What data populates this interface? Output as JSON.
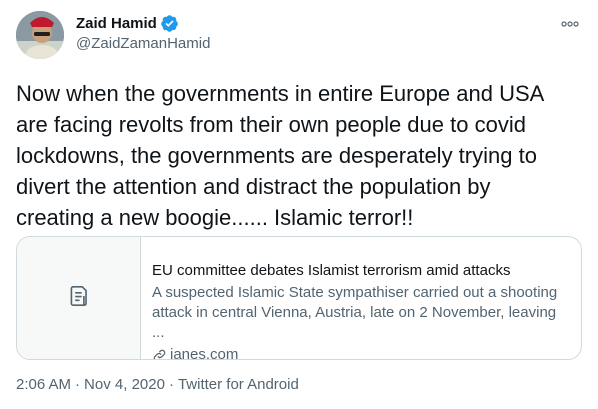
{
  "author": {
    "display_name": "Zaid Hamid",
    "handle": "@ZaidZamanHamid",
    "verified": true
  },
  "icons": {
    "verified": "verified-badge-icon",
    "more": "more-options-icon",
    "card_thumb": "article-document-icon",
    "link": "link-icon"
  },
  "tweet": {
    "text": "Now when the governments in entire Europe and USA\nare facing revolts from their own people due to covid\nlockdowns, the governments are desperately trying to\ndivert the attention and distract the population by\ncreating a new boogie...... Islamic terror!!"
  },
  "card": {
    "title": "EU committee debates Islamist terrorism amid attacks",
    "description_line1": "A suspected Islamic State sympathiser carried out a shooting",
    "description_line2": "attack in central Vienna, Austria, late on 2 November, leaving ...",
    "domain": "janes.com"
  },
  "meta": {
    "time": "2:06 AM",
    "separator": "·",
    "date": "Nov 4, 2020",
    "source": "Twitter for Android"
  },
  "colors": {
    "text_primary": "#0f1419",
    "text_secondary": "#536471",
    "verified_blue": "#1d9bf0",
    "card_border": "#cfd9de"
  }
}
